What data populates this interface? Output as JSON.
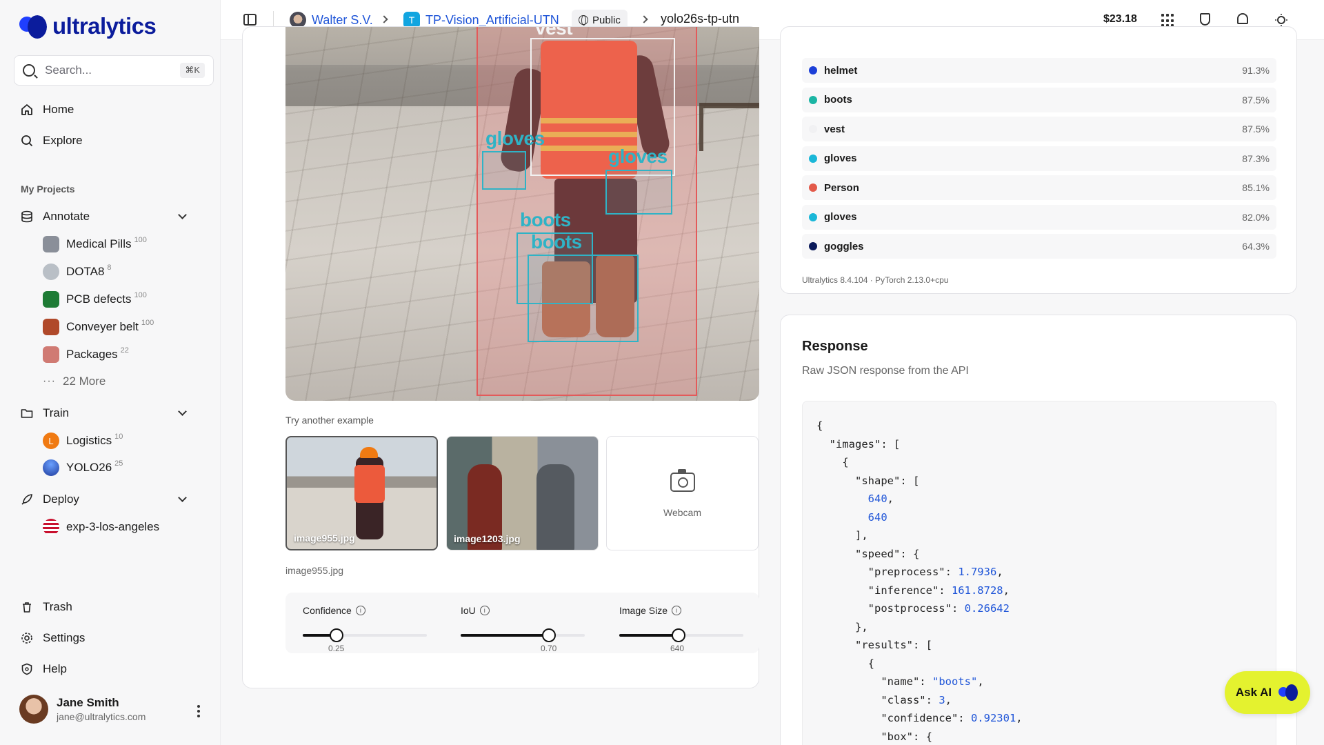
{
  "brand": {
    "name": "ultralytics"
  },
  "search": {
    "placeholder": "Search...",
    "shortcut": "⌘K"
  },
  "nav": {
    "home": "Home",
    "explore": "Explore",
    "my_projects": "My Projects",
    "annotate": "Annotate",
    "train": "Train",
    "deploy": "Deploy",
    "trash": "Trash",
    "settings": "Settings",
    "help": "Help"
  },
  "annotate_projects": [
    {
      "name": "Medical Pills",
      "count": "100",
      "color": "#8a8f99"
    },
    {
      "name": "DOTA8",
      "count": "8",
      "color": "#b9bfc6"
    },
    {
      "name": "PCB defects",
      "count": "100",
      "color": "#1e7b35"
    },
    {
      "name": "Conveyer belt",
      "count": "100",
      "color": "#b0492a"
    },
    {
      "name": "Packages",
      "count": "22",
      "color": "#d07a73"
    }
  ],
  "annotate_more": "22 More",
  "train_projects": [
    {
      "name": "Logistics",
      "count": "10",
      "color": "#f07a12",
      "letter": "L"
    },
    {
      "name": "YOLO26",
      "count": "25",
      "color": "#1f55d8",
      "letter": ""
    }
  ],
  "deploy_items": [
    {
      "name": "exp-3-los-angeles"
    }
  ],
  "user": {
    "name": "Jane Smith",
    "email": "jane@ultralytics.com"
  },
  "topbar": {
    "owner": "Walter S.V.",
    "project_badge": "T",
    "project": "TP-Vision_Artificial-UTN",
    "visibility": "Public",
    "model": "yolo26s-tp-utn",
    "balance": "$23.18"
  },
  "preview": {
    "labels": {
      "vest": "vest",
      "gloves_left": "gloves",
      "gloves_right": "gloves",
      "boots_top": "boots",
      "boots_bottom": "boots"
    }
  },
  "examples": {
    "title": "Try another example",
    "items": [
      "image955.jpg",
      "image1203.jpg"
    ],
    "webcam": "Webcam",
    "selected": "image955.jpg"
  },
  "controls": [
    {
      "label": "Confidence",
      "value": "0.25",
      "fraction": 0.27
    },
    {
      "label": "IoU",
      "value": "0.70",
      "fraction": 0.71
    },
    {
      "label": "Image Size",
      "value": "640",
      "fraction": 0.48
    }
  ],
  "detections": [
    {
      "name": "helmet",
      "pct": "91.3%",
      "color": "#1c3fd8"
    },
    {
      "name": "boots",
      "pct": "87.5%",
      "color": "#1bb5a4"
    },
    {
      "name": "vest",
      "pct": "87.5%",
      "color": "#f1f1f3"
    },
    {
      "name": "gloves",
      "pct": "87.3%",
      "color": "#1ab7d8"
    },
    {
      "name": "Person",
      "pct": "85.1%",
      "color": "#e35a4a"
    },
    {
      "name": "gloves",
      "pct": "82.0%",
      "color": "#1ab7d8"
    },
    {
      "name": "goggles",
      "pct": "64.3%",
      "color": "#0b1a5a"
    }
  ],
  "version": "Ultralytics 8.4.104 · PyTorch 2.13.0+cpu",
  "response": {
    "title": "Response",
    "subtitle": "Raw JSON response from the API",
    "json_lines": [
      "{",
      "  \"images\": [",
      "    {",
      "      \"shape\": [",
      "        640,",
      "        640",
      "      ],",
      "      \"speed\": {",
      "        \"preprocess\": 1.7936,",
      "        \"inference\": 161.8728,",
      "        \"postprocess\": 0.26642",
      "      },",
      "      \"results\": [",
      "        {",
      "          \"name\": \"boots\",",
      "          \"class\": 3,",
      "          \"confidence\": 0.92301,",
      "          \"box\": {"
    ]
  },
  "ask_ai": "Ask AI"
}
